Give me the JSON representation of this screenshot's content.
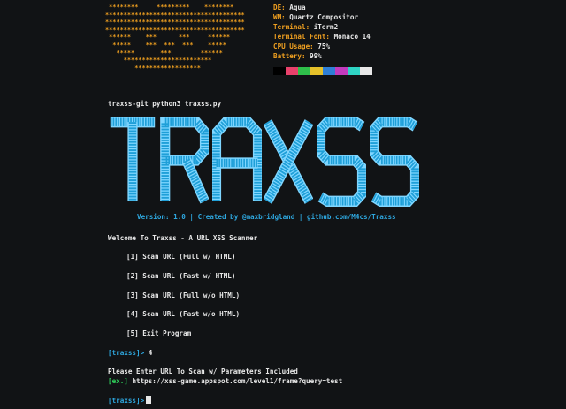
{
  "ascii_art": [
    " ********     *********    ********",
    "**************************************",
    "**************************************",
    "**************************************",
    " ******    ***      ***     ******",
    "  *****    ***  ***  ***    *****",
    "   *****       ***        ******",
    "     ************************",
    "        ******************"
  ],
  "info": [
    {
      "key": "DE:",
      "value": "Aqua"
    },
    {
      "key": "WM:",
      "value": "Quartz Compositor"
    },
    {
      "key": "Terminal:",
      "value": "iTerm2"
    },
    {
      "key": "Terminal Font:",
      "value": "Monaco 14"
    },
    {
      "key": "CPU Usage:",
      "value": "75%"
    },
    {
      "key": "Battery:",
      "value": "99%"
    }
  ],
  "palette": [
    "#000000",
    "#e8416b",
    "#2fbf4a",
    "#e6c12a",
    "#2f7fd6",
    "#c23bbd",
    "#2fd4c4",
    "#e8e8e8"
  ],
  "command": "traxss-git python3 traxss.py",
  "logo_text": "TRAXSS",
  "logo_letters": [
    "T",
    "R",
    "A",
    "X",
    "S",
    "S"
  ],
  "logo_colors": {
    "fill": "#1f9fd8",
    "edge": "#7fd6ff"
  },
  "version_line": "Version: 1.0 | Created by @maxbridgland | github.com/M4cs/Traxss",
  "welcome": "Welcome To Traxss - A URL XSS Scanner",
  "menu": [
    "[1] Scan URL (Full w/ HTML)",
    "[2] Scan URL (Fast w/ HTML)",
    "[3] Scan URL (Full w/o HTML)",
    "[4] Scan URL (Fast w/o HTML)",
    "[5] Exit Program"
  ],
  "prompt_label": "[traxss]>",
  "choice": "4",
  "enter_url": "Please Enter URL To Scan w/ Parameters Included",
  "example_prefix": "[ex.]",
  "example_url": "https://xss-game.appspot.com/level1/frame?query=test",
  "final_prompt": "[traxss]>"
}
